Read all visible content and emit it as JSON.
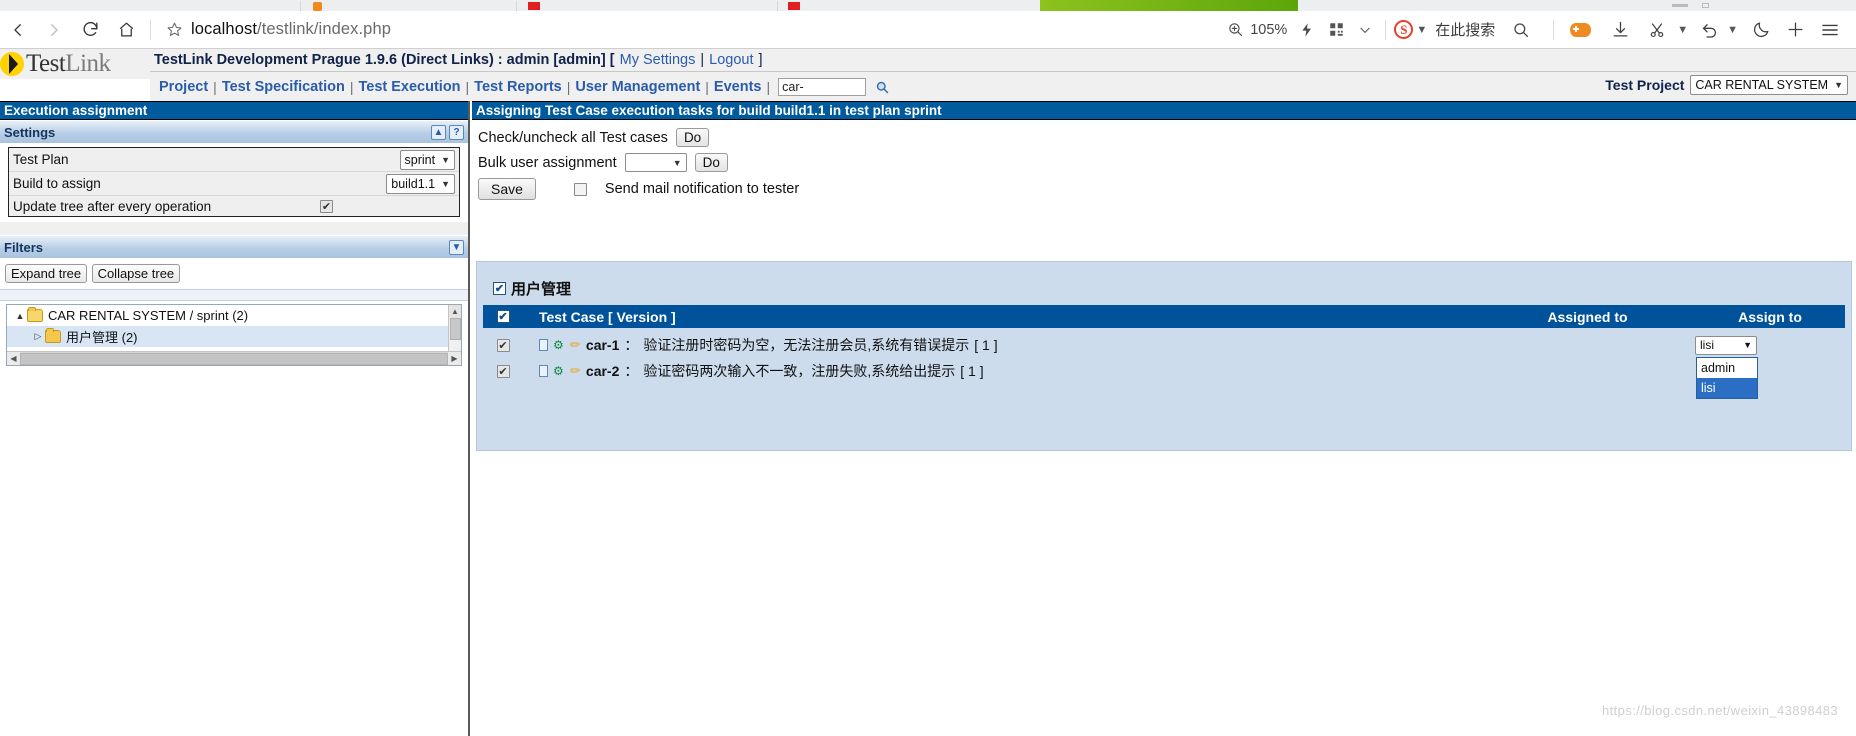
{
  "browser": {
    "nav": {
      "back_icon": "back-arrow-icon",
      "forward_icon": "forward-arrow-icon",
      "reload_icon": "reload-icon",
      "home_icon": "home-icon"
    },
    "url": {
      "host": "localhost",
      "path": "/testlink/index.php",
      "full": "localhost/testlink/index.php",
      "star_icon": "bookmark-star-icon"
    },
    "zoom": "105%",
    "zoom_icon": "zoom-in-icon",
    "flash_icon": "lightning-icon",
    "qrcode_icon": "qrcode-icon",
    "chevron_icon": "chevron-down-icon",
    "search_engine": "S",
    "search_placeholder": "在此搜索",
    "search_icon": "magnifier-icon",
    "gamepad_icon": "gamepad-icon",
    "download_icon": "download-icon",
    "scissors_icon": "scissors-icon",
    "undo_icon": "undo-icon",
    "moon_icon": "moon-icon",
    "plus_icon": "plus-icon",
    "menu_icon": "hamburger-menu-icon"
  },
  "testlink": {
    "logo_first": "Test",
    "logo_second": "Link",
    "title_main": "TestLink Development Prague 1.9.6 (Direct Links) : admin [admin] [",
    "my_settings": "My Settings",
    "title_sep": "|",
    "logout": "Logout",
    "title_close": "]",
    "menu": [
      "Project",
      "Test Specification",
      "Test Execution",
      "Test Reports",
      "User Management",
      "Events"
    ],
    "menu_separator": "|",
    "search_value": "car-",
    "search_placeholder": "",
    "search_button_icon": "magnifier-icon",
    "project_label": "Test Project",
    "project_value": "CAR RENTAL SYSTEM"
  },
  "left_pane": {
    "header": "Execution assignment",
    "settings": {
      "title": "Settings",
      "collapse_icon": "collapse-up-icon",
      "help_icon": "help-question-icon",
      "rows": [
        {
          "label": "Test Plan",
          "value": "sprint",
          "type": "select"
        },
        {
          "label": "Build to assign",
          "value": "build1.1",
          "type": "select"
        },
        {
          "label": "Update tree after every operation",
          "value": "✔",
          "type": "checkbox"
        }
      ]
    },
    "filters": {
      "title": "Filters",
      "expand_icon": "expand-down-icon",
      "expand_tree": "Expand tree",
      "collapse_tree": "Collapse tree"
    },
    "tree": {
      "root": {
        "label": "CAR RENTAL SYSTEM / sprint (2)",
        "arrow": "▲",
        "icon": "open-folder-icon"
      },
      "child": {
        "label": "用户管理 (2)",
        "arrow": "▷",
        "icon": "folder-icon"
      },
      "scroll_up": "▲",
      "scroll_down": "▼",
      "scroll_left": "◀",
      "scroll_right": "▶"
    }
  },
  "right_pane": {
    "header": "Assigning Test Case execution tasks for build build1.1 in test plan sprint",
    "check_all_label": "Check/uncheck all Test cases",
    "check_all_button": "Do",
    "bulk_label": "Bulk user assignment",
    "bulk_value": "",
    "bulk_button": "Do",
    "save_button": "Save",
    "mail_checkbox_checked": false,
    "mail_label": "Send mail notification to tester",
    "group_name": "用户管理",
    "group_checkbox": "☑",
    "columns": {
      "check": "☑",
      "test_case": "Test Case [ Version ]",
      "assigned_to": "Assigned to",
      "assign_to": "Assign to"
    },
    "rows": [
      {
        "checked": "✔",
        "id": "car-1",
        "separator": "：",
        "name": "验证注册时密码为空，无法注册会员,系统有错误提示",
        "version": "[ 1 ]",
        "assigned_to": "",
        "assign_to": "lisi",
        "icons": [
          "document-icon",
          "gear-icon",
          "pencil-icon"
        ]
      },
      {
        "checked": "✔",
        "id": "car-2",
        "separator": "：",
        "name": "验证密码两次输入不一致，注册失败,系统给出提示",
        "version": "[ 1 ]",
        "assigned_to": "",
        "assign_to": "",
        "icons": [
          "document-icon",
          "gear-icon",
          "pencil-icon"
        ]
      }
    ],
    "dropdown": {
      "open": true,
      "options": [
        "admin",
        "lisi"
      ],
      "selected": "lisi"
    }
  },
  "watermark": "https://blog.csdn.net/weixin_43898483",
  "colors": {
    "bluebar": "#005a9e",
    "table_header": "#00529b",
    "table_bg": "#ccdced",
    "link": "#2b5caa",
    "dropdown_highlight": "#2a6fc4"
  }
}
